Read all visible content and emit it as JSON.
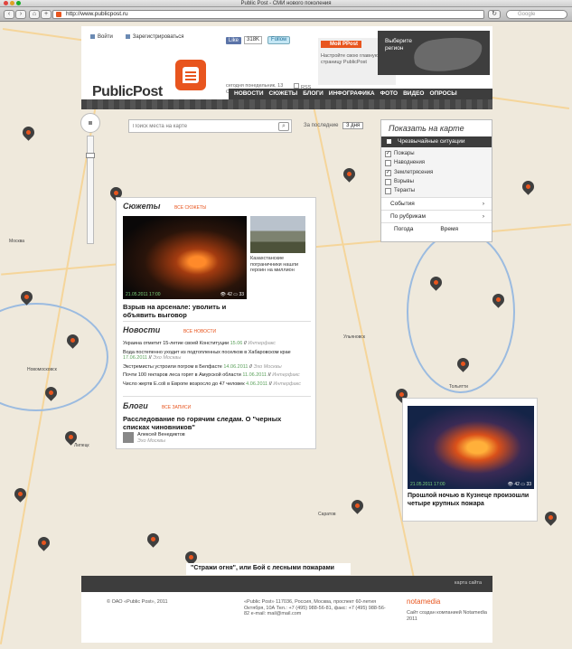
{
  "window": {
    "title": "Public Post - СМИ нового поколения"
  },
  "browser": {
    "url": "http://www.publicpost.ru",
    "search_placeholder": "Google"
  },
  "header": {
    "login": "Войти",
    "register": "Зарегистрироваться",
    "like": "Like",
    "like_count": "318K",
    "follow": "Follow",
    "logo": "PublicPost",
    "date": "сегодня понедельник, 13 Сентября, 17:25",
    "rss": "RSS",
    "my_pp": "Мой PPost",
    "my_pp_text": "Настройте свою главную страницу PublicPost",
    "region": "Выберите регион",
    "nav": [
      "НОВОСТИ",
      "СЮЖЕТЫ",
      "БЛОГИ",
      "ИНФОГРАФИКА",
      "ФОТО",
      "ВИДЕО",
      "ОПРОСЫ"
    ]
  },
  "map_controls": {
    "search_placeholder": "Поиск места на карте",
    "period_label": "За последние",
    "period_value": "3 дня"
  },
  "layers": {
    "title": "Показать на карте",
    "category": "Чрезвычайные ситуации",
    "items": [
      {
        "label": "Пожары",
        "checked": true
      },
      {
        "label": "Наводнения",
        "checked": false
      },
      {
        "label": "Землетрясения",
        "checked": true
      },
      {
        "label": "Взрывы",
        "checked": false
      },
      {
        "label": "Теракты",
        "checked": false
      }
    ],
    "events": "События",
    "rubrics": "По рубрикам",
    "weather": "Погода",
    "time": "Время"
  },
  "panel": {
    "stories_title": "Сюжеты",
    "stories_link": "все сюжеты",
    "photo_date": "21.05.2011 17:00",
    "photo_views": "42",
    "photo_comments": "33",
    "side_caption": "Казахстанские пограничники нашли героин на миллион",
    "story_title": "Взрыв на арсенале: уволить и объявить выговор",
    "news_title": "Новости",
    "news_link": "все новости",
    "news": [
      {
        "text": "Украина отметит 15-летие своей Конституции",
        "date": "15.06",
        "src": "Интерфакс"
      },
      {
        "text": "Вода постепенно уходит из подтопленных поселков в Хабаровском крае",
        "date": "17.06.2011",
        "src": "Эхо Москвы"
      },
      {
        "text": "Экстремисты устроили погром в Белфасте",
        "date": "14.06.2011",
        "src": "Эхо Москвы"
      },
      {
        "text": "Почти 100 гектаров леса горят в Амурской области",
        "date": "11.06.2011",
        "src": "Интерфакс"
      },
      {
        "text": "Число жертв E.coli в Европе возросло до 47 человек",
        "date": "4.06.2011",
        "src": "Интерфакс"
      }
    ],
    "blogs_title": "Блоги",
    "blogs_link": "все записи",
    "blog_post": "Расследование по горячим следам. О \"черных списках чиновников\"",
    "author": "Алексей Венедиктов",
    "author_src": "Эхо Москвы"
  },
  "panel2": {
    "date": "21.05.2011 17:00",
    "views": "42",
    "comments": "33",
    "caption": "Прошлой ночью в Кузнеце произошли четыре крупных пожара"
  },
  "teaser": "\"Стражи огня\", или Бой с лесными пожарами",
  "footer": {
    "map_link": "карта сайта",
    "copyright": "© ОАО «Public Post», 2011",
    "address": "«Public Post» 117036, Россия, Москва, проспект 60-летия Октября, 10А Тел.: +7 (495) 988-56-81, факс: +7 (495) 988-56-82 e-mail: mail@mail.com",
    "network_logo": "notamedia",
    "network_text": "Сайт создан компанией Notamedia 2011"
  },
  "colors": {
    "accent": "#e8551e",
    "dark": "#3d3d3d"
  }
}
